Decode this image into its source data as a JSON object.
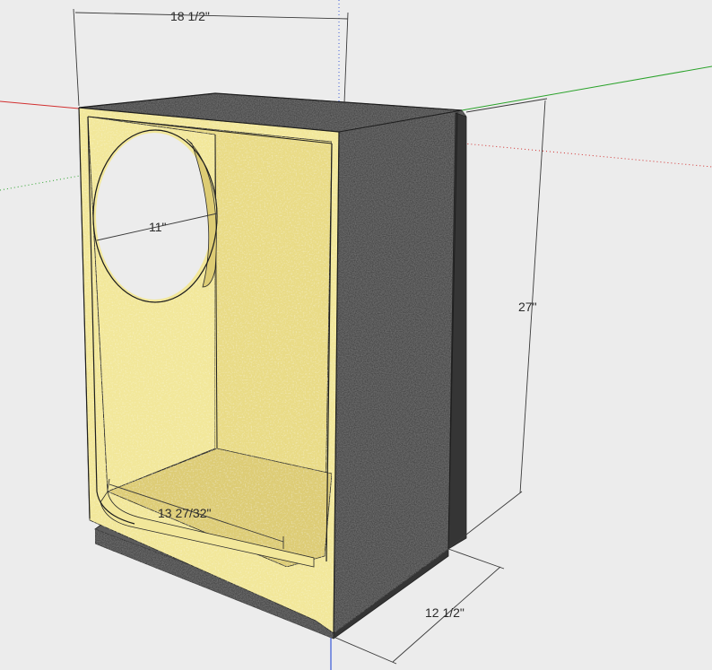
{
  "dimensions": {
    "width": "18 1/2\"",
    "height": "27\"",
    "depth": "12 1/2\"",
    "cutout_diameter": "11\"",
    "inner_width": "13 27/32\""
  },
  "colors": {
    "background": "#ececec",
    "carpet": "#4a4a4a",
    "carpet_dark": "#353535",
    "carpet_light": "#5c5c5c",
    "mdf_face": "#f2e79a",
    "mdf_inner": "#e9db86",
    "mdf_floor": "#ddcc74",
    "axis_red": "#d23030",
    "axis_green": "#2aa22a",
    "axis_blue": "#3a5ad8",
    "dimension_line": "#3a3a3a"
  }
}
